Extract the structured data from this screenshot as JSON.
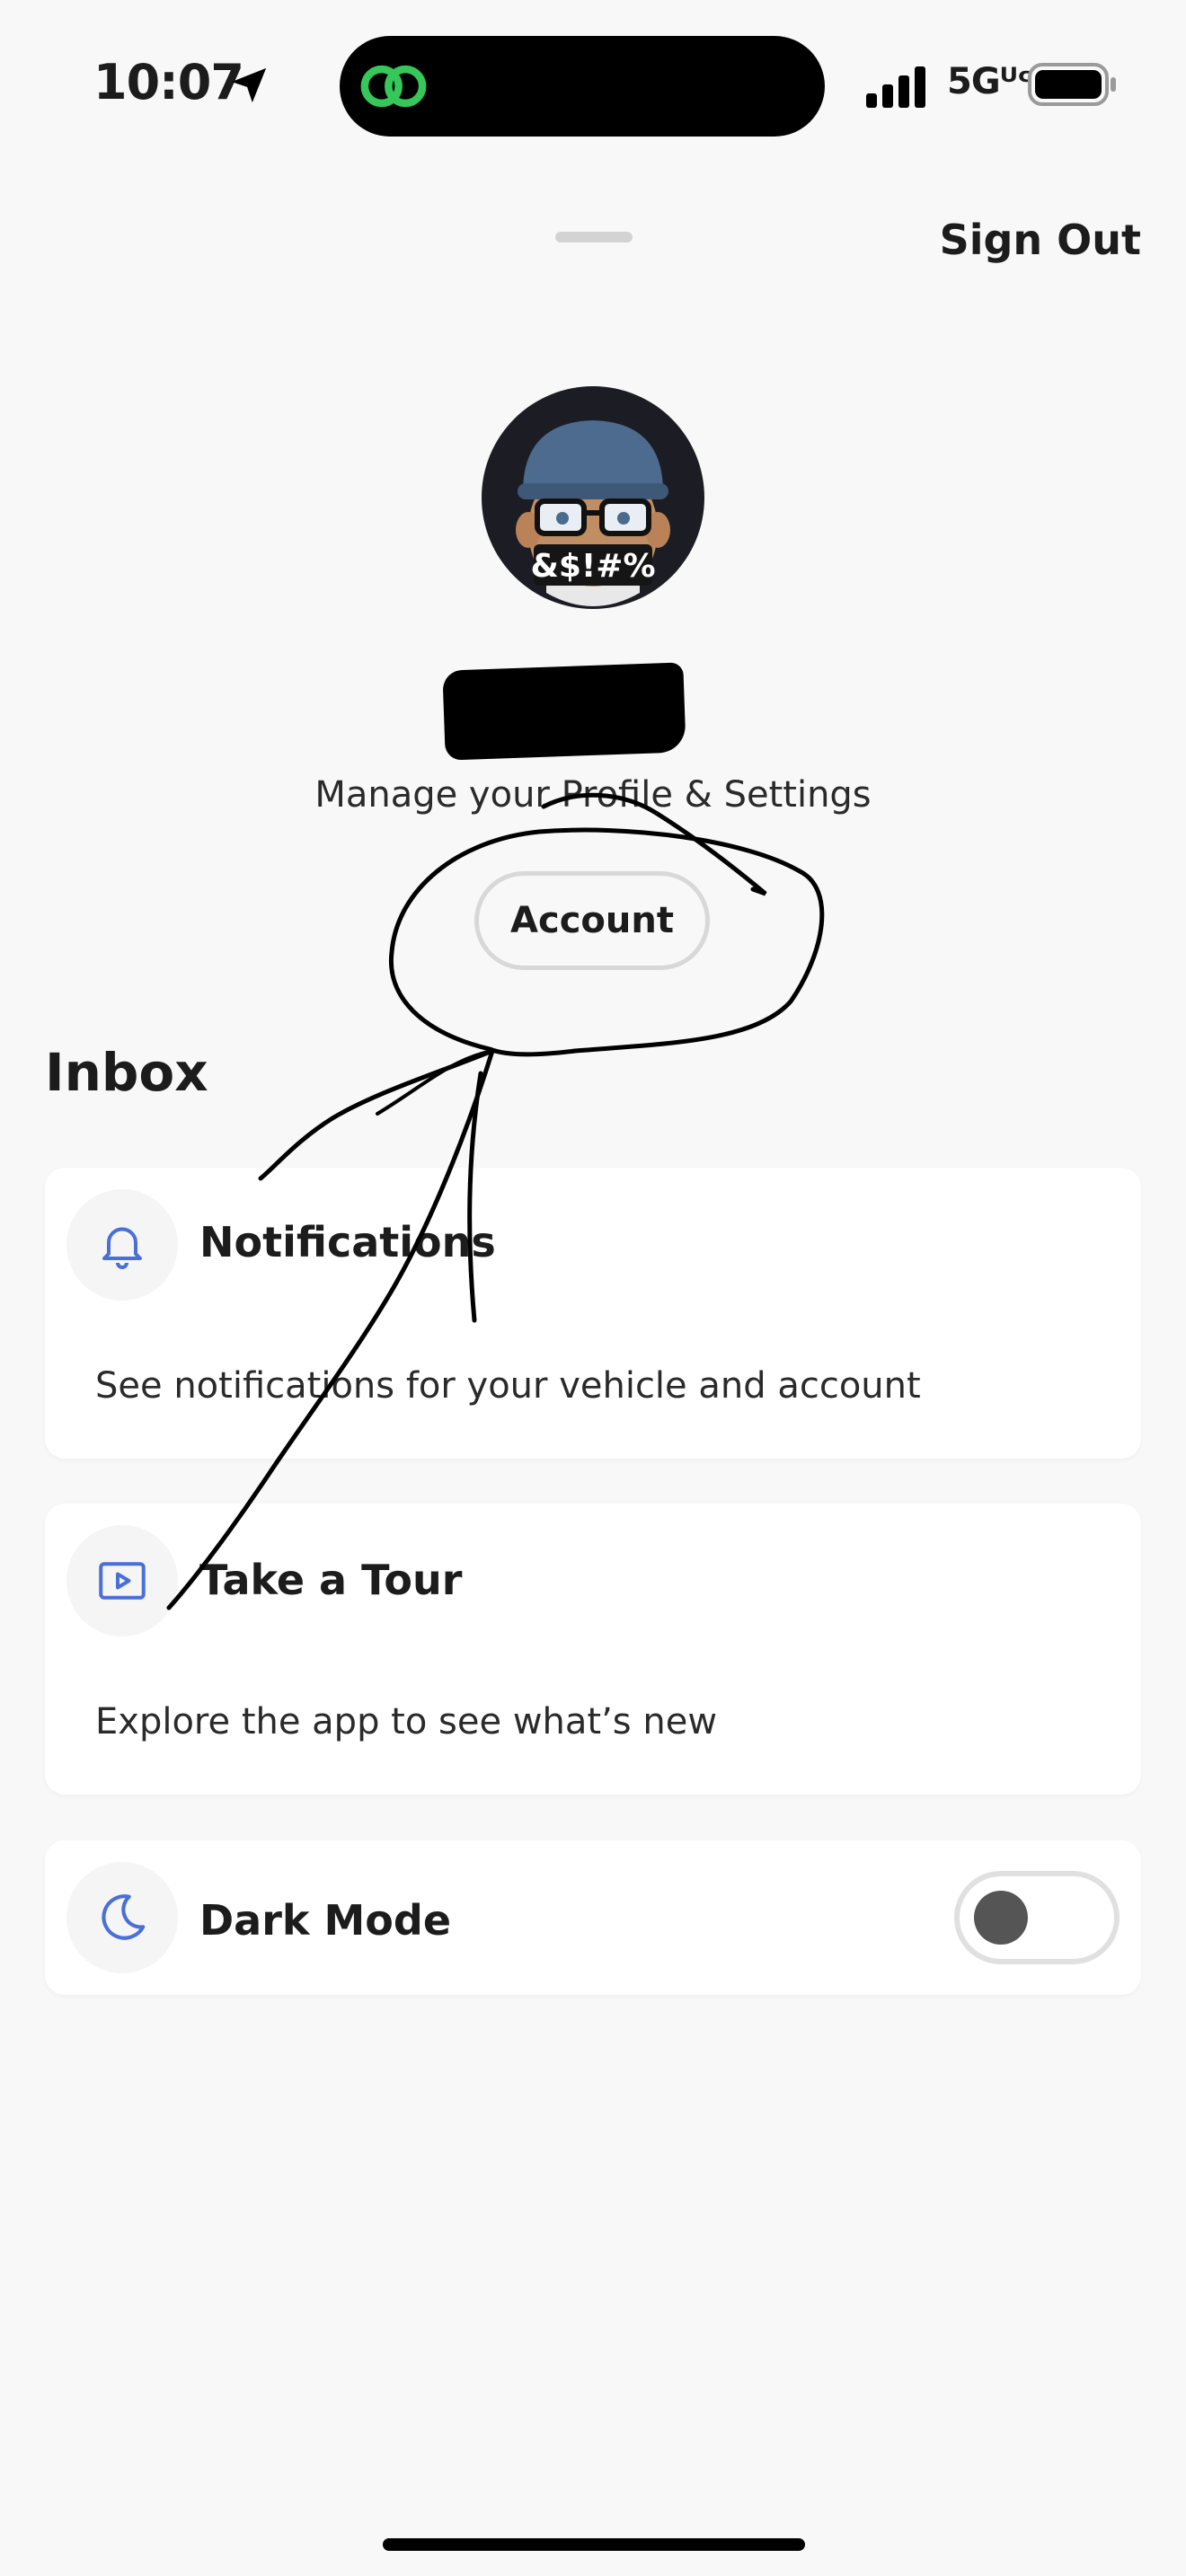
{
  "status_bar": {
    "time": "10:07",
    "network": "5Gᵁᶜ",
    "icons": [
      "location-arrow-icon",
      "linked-rings-icon",
      "signal-bars-icon",
      "battery-icon"
    ],
    "island_icon_color": "#35c759"
  },
  "header": {
    "sign_out_label": "Sign Out"
  },
  "profile": {
    "avatar_mask_text": "&$!#%",
    "manage_text": "Manage your Profile & Settings",
    "account_button_label": "Account"
  },
  "inbox": {
    "title": "Inbox",
    "cards": [
      {
        "icon": "bell-icon",
        "title": "Notifications",
        "description": "See notifications for your vehicle and account"
      },
      {
        "icon": "play-video-icon",
        "title": "Take a Tour",
        "description": "Explore the app to see what’s new"
      },
      {
        "icon": "moon-icon",
        "title": "Dark Mode",
        "toggle_on": false
      }
    ]
  },
  "colors": {
    "accent_icon": "#4a6fd6",
    "background": "#f8f8f8",
    "card": "#ffffff"
  }
}
